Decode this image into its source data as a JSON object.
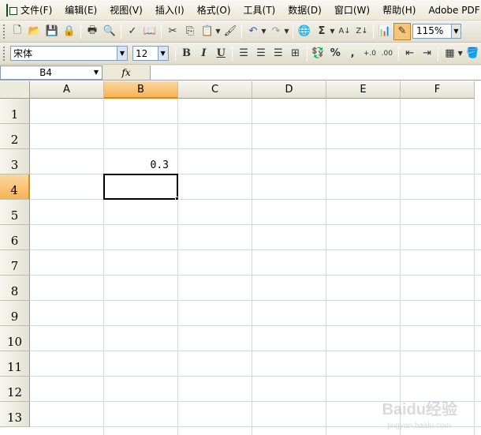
{
  "menu": {
    "items": [
      "文件(F)",
      "编辑(E)",
      "视图(V)",
      "插入(I)",
      "格式(O)",
      "工具(T)",
      "数据(D)",
      "窗口(W)",
      "帮助(H)",
      "Adobe PDF"
    ]
  },
  "toolbar": {
    "zoom": "115%"
  },
  "format_toolbar": {
    "font": "宋体",
    "size": "12",
    "bold": "B",
    "italic": "I",
    "underline": "U",
    "percent": "%",
    "comma": ","
  },
  "formula_bar": {
    "name_box": "B4",
    "fx_label": "fx",
    "formula": ""
  },
  "sheet": {
    "columns": [
      "A",
      "B",
      "C",
      "D",
      "E",
      "F"
    ],
    "rows": [
      "1",
      "2",
      "3",
      "4",
      "5",
      "6",
      "7",
      "8",
      "9",
      "10",
      "11",
      "12",
      "13"
    ],
    "cells": {
      "B3": "0.3"
    },
    "active_cell": "B4"
  },
  "watermark": {
    "text": "Baidu经验",
    "sub": "jingyan.baidu.com"
  },
  "colors": {
    "selected_header": "#f6b357",
    "gridline": "#d0d7e5"
  }
}
